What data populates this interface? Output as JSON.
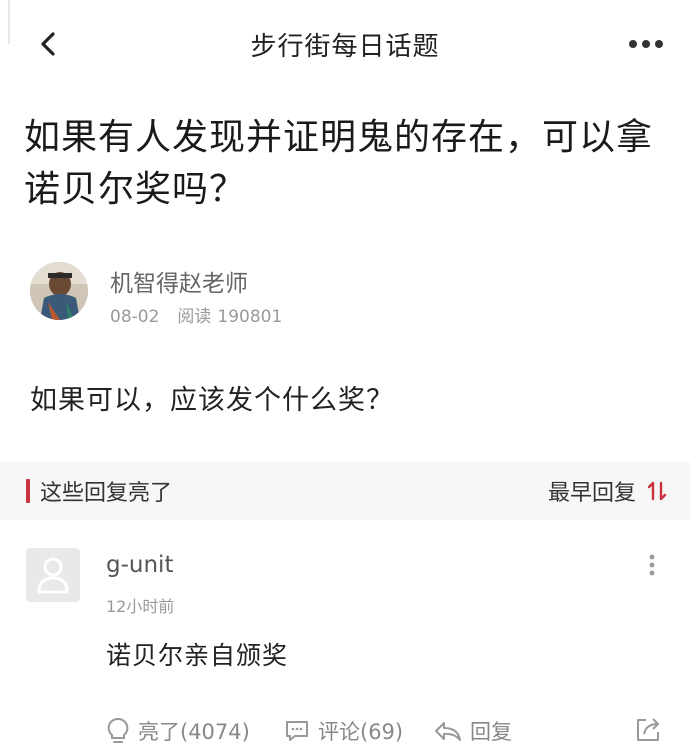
{
  "nav": {
    "title": "步行街每日话题",
    "back_icon": "chevron-left-icon",
    "more_icon": "more-horizontal-icon"
  },
  "post": {
    "title": "如果有人发现并证明鬼的存在，可以拿诺贝尔奖吗？",
    "body": "如果可以，应该发个什么奖？",
    "author": {
      "name": "机智得赵老师",
      "date": "08-02",
      "reads_label": "阅读",
      "reads": "190801"
    }
  },
  "replies_section": {
    "title": "这些回复亮了",
    "sort_label": "最早回复",
    "accent_color": "#c9333d"
  },
  "reply": {
    "user": "g-unit",
    "time": "12小时前",
    "text": "诺贝尔亲自颁奖",
    "actions": {
      "like": "亮了(4074)",
      "comment": "评论(69)",
      "reply": "回复"
    }
  }
}
